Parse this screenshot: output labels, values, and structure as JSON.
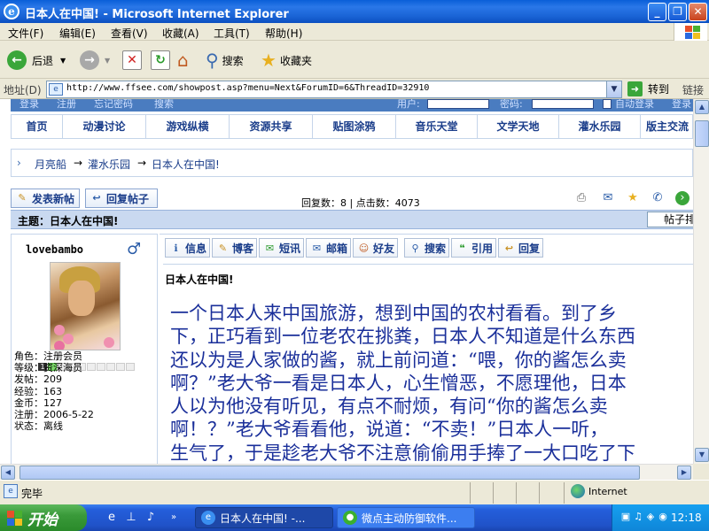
{
  "window": {
    "title": "日本人在中国! - Microsoft Internet Explorer",
    "minimize_glyph": "_",
    "restore_glyph": "❐",
    "close_glyph": "✕"
  },
  "menu": {
    "items": [
      "文件(F)",
      "编辑(E)",
      "查看(V)",
      "收藏(A)",
      "工具(T)",
      "帮助(H)"
    ]
  },
  "toolbar": {
    "back_label": "后退",
    "search_label": "搜索",
    "favorites_label": "收藏夹"
  },
  "address": {
    "label": "地址(D)",
    "url": "http://www.ffsee.com/showpost.asp?menu=Next&ForumID=6&ThreadID=32910",
    "go_label": "转到",
    "links_label": "链接"
  },
  "forum": {
    "top_links": [
      "登录",
      "注册",
      "忘记密码",
      "搜索"
    ],
    "user_label": "用户:",
    "password_label": "密码:",
    "auto_login_label": "自动登录",
    "login_button": "登录",
    "nav": [
      "首页",
      "动漫讨论",
      "游戏纵横",
      "资源共享",
      "贴图涂鸦",
      "音乐天堂",
      "文学天地",
      "灌水乐园",
      "版主交流"
    ],
    "breadcrumb": [
      "月亮船",
      "灌水乐园",
      "日本人在中国!"
    ],
    "breadcrumb_sep": "→",
    "new_post_label": "发表新帖",
    "reply_post_label": "回复帖子",
    "stats_text": "回复数：8 | 点击数：4073",
    "subject_text": "主题：日本人在中国!",
    "sort_label": "帖子排序"
  },
  "user": {
    "name": "lovebambo",
    "level_marker": "1",
    "info": [
      "角色：注册会员",
      "等级：资深海员",
      "发帖：209",
      "经验：163",
      "金币：127",
      "注册：2006-5-22",
      "状态：离线"
    ]
  },
  "post": {
    "actions": [
      "信息",
      "博客",
      "短讯",
      "邮箱",
      "好友",
      "搜索",
      "引用",
      "回复"
    ],
    "title": "日本人在中国!",
    "lines": [
      "一个日本人来中国旅游，想到中国的农村看看。到了乡",
      "下，正巧看到一位老农在挑粪，日本人不知道是什么东西",
      "还以为是人家做的酱，就上前问道：“喂，你的酱怎么卖",
      "啊？”老大爷一看是日本人，心生憎恶，不愿理他，日本",
      "人以为他没有听见，有点不耐烦，有问“你的酱怎么卖",
      "啊！？”老大爷看看他，说道：“不卖！”日本人一听，",
      "生气了，于是趁老大爷不注意偷偷用手捧了一大口吃了下"
    ]
  },
  "status": {
    "text": "完毕",
    "zone": "Internet"
  },
  "taskbar": {
    "start_label": "开始",
    "tasks": [
      "日本人在中国! -...",
      "微点主动防御软件..."
    ],
    "clock": "12:18"
  },
  "colors": {
    "title_bar": "#0a5fd8",
    "forum_link": "#1a3d8a",
    "post_text": "#1a2f9a",
    "taskbar": "#245edb",
    "start_button": "#3a9a3a"
  }
}
